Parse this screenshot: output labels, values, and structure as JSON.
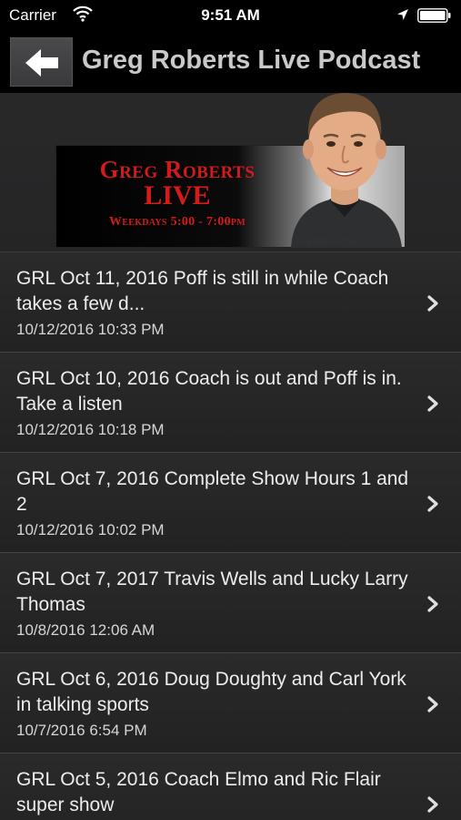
{
  "status_bar": {
    "carrier": "Carrier",
    "time": "9:51 AM",
    "icons": [
      "wifi-icon",
      "location-arrow-icon",
      "battery-icon"
    ]
  },
  "nav_bar": {
    "back_icon": "arrow-left-icon",
    "title": "Greg Roberts Live Podcast"
  },
  "banner": {
    "name": "Greg Roberts",
    "live": "LIVE",
    "schedule": "Weekdays 5:00 - 7:00pm",
    "small_logo": "Greg Roberts LIVE"
  },
  "episodes": [
    {
      "title": "GRL Oct 11, 2016 Poff is still in while Coach takes a few d...",
      "date": "10/12/2016 10:33 PM"
    },
    {
      "title": "GRL Oct 10, 2016 Coach is out and Poff is in. Take a listen",
      "date": "10/12/2016 10:18 PM"
    },
    {
      "title": "GRL Oct 7, 2016 Complete Show Hours 1 and 2",
      "date": "10/12/2016 10:02 PM"
    },
    {
      "title": "GRL Oct 7, 2017 Travis Wells and Lucky Larry Thomas",
      "date": "10/8/2016 12:06 AM"
    },
    {
      "title": "GRL Oct 6, 2016 Doug Doughty and Carl York in talking sports",
      "date": "10/7/2016 6:54 PM"
    },
    {
      "title": "GRL Oct 5, 2016 Coach Elmo and Ric Flair super show",
      "date": ""
    }
  ],
  "colors": {
    "banner_red": "#d31b1b",
    "nav_background": "#000000",
    "list_background": "#242425"
  }
}
